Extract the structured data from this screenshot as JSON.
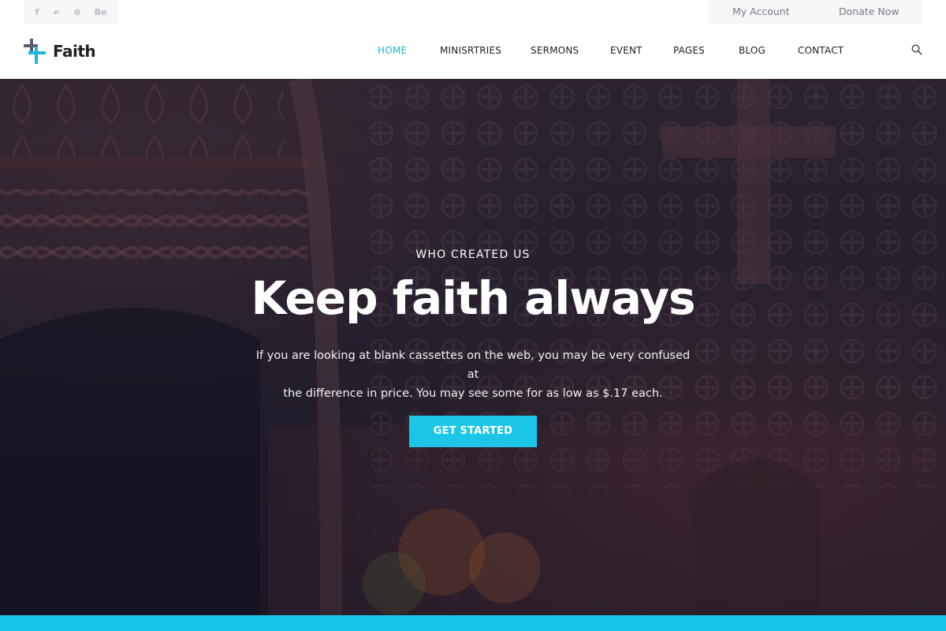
{
  "topbar": {
    "social_icons": [
      {
        "name": "facebook-icon",
        "glyph": "f"
      },
      {
        "name": "twitter-icon",
        "glyph": "☙"
      },
      {
        "name": "dribbble-icon",
        "glyph": "⊛"
      },
      {
        "name": "behance-icon",
        "glyph": "Be"
      }
    ],
    "my_account": "My Account",
    "donate_now": "Donate Now"
  },
  "nav": {
    "logo_text": "Faith",
    "items": [
      "HOME",
      "MINISRTRIES",
      "SERMONS",
      "EVENT",
      "PAGES",
      "BLOG",
      "CONTACT"
    ],
    "active": "HOME",
    "search_icon": "search-icon"
  },
  "hero": {
    "eyebrow": "WHO CREATED US",
    "title": "Keep faith always",
    "description_line1": "If you are looking at blank cassettes on the web, you may be very confused at",
    "description_line2": "the difference in price. You may see some for as low as $.17 each.",
    "cta_label": "GET STARTED"
  },
  "colors": {
    "accent": "#1bc6e9",
    "nav_active": "#1bb7de",
    "logo_dark": "#5a5f6d",
    "text_dark": "#222222"
  }
}
